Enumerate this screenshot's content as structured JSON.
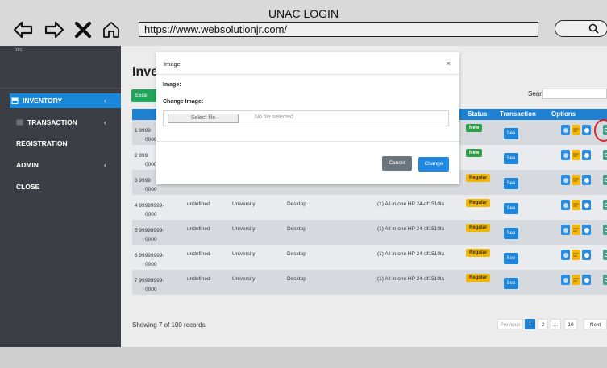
{
  "window": {
    "title": "UNAC LOGIN",
    "url": "https://www.websolutionjr.com/"
  },
  "sidebar": {
    "brand": "otic",
    "items": [
      {
        "label": "INVENTORY",
        "icon": "inventory-icon",
        "has_chevron": true,
        "chevron": "‹",
        "active": true
      },
      {
        "label": "TRANSACTION",
        "icon": "transaction-icon",
        "has_chevron": true,
        "chevron": "‹",
        "active": false
      },
      {
        "label": "REGISTRATION",
        "icon": "",
        "has_chevron": false,
        "chevron": "",
        "active": false
      },
      {
        "label": "ADMIN",
        "icon": "",
        "has_chevron": true,
        "chevron": "‹",
        "active": false
      },
      {
        "label": "CLOSE",
        "icon": "",
        "has_chevron": false,
        "chevron": "",
        "active": false
      }
    ]
  },
  "main": {
    "title": "Inver",
    "excel_label": "Exce",
    "search_label": "Search:",
    "search_value": "",
    "columns": [
      "Co",
      "Status",
      "Transaction",
      "Options"
    ],
    "rows": [
      {
        "id_top": "1  9999",
        "id_bottom": "0000",
        "c2": "",
        "c3": "",
        "c4": "",
        "c5": "",
        "status": "New",
        "status_type": "new",
        "see": "See"
      },
      {
        "id_top": "2  999",
        "id_bottom": "0000",
        "c2": "",
        "c3": "",
        "c4": "",
        "c5": "",
        "status": "New",
        "status_type": "new",
        "see": "See"
      },
      {
        "id_top": "3  9999",
        "id_bottom": "0000",
        "c2": "",
        "c3": "",
        "c4": "",
        "c5": "",
        "status": "Regular",
        "status_type": "regular",
        "see": "See"
      },
      {
        "id_top": "4  99999999-",
        "id_bottom": "0000",
        "c2": "undefined",
        "c3": "University",
        "c4": "Desktop",
        "c5": "(1) All in one HP 24-df1510la",
        "status": "Regular",
        "status_type": "regular",
        "see": "See"
      },
      {
        "id_top": "5  99999999-",
        "id_bottom": "0000",
        "c2": "undefined",
        "c3": "University",
        "c4": "Desktop",
        "c5": "(1) All in one HP 24-df1510la",
        "status": "Regular",
        "status_type": "regular",
        "see": "See"
      },
      {
        "id_top": "6  99999999-",
        "id_bottom": "0000",
        "c2": "undefined",
        "c3": "University",
        "c4": "Desktop",
        "c5": "(1) All in one HP 24-df1510la",
        "status": "Regular",
        "status_type": "regular",
        "see": "See"
      },
      {
        "id_top": "7  99999999-",
        "id_bottom": "0000",
        "c2": "undefined",
        "c3": "University",
        "c4": "Desktop",
        "c5": "(1) All in one HP 24-df1510la",
        "status": "Regular",
        "status_type": "regular",
        "see": "See"
      }
    ],
    "showing": "Showing 7 of 100 records",
    "pagination": {
      "prev": "Previous",
      "p1": "1",
      "p2": "2",
      "dots": "...",
      "p10": "10",
      "next": "Next"
    }
  },
  "modal": {
    "title": "Image",
    "close": "×",
    "image_label": "Image:",
    "change_label": "Change Image:",
    "file_button": "Select file",
    "file_status": "No file selected",
    "cancel": "Cancel",
    "change": "Change"
  },
  "colors": {
    "sidebar_bg": "#3b3e45",
    "accent": "#1f7fd0",
    "new_badge": "#2e9e49",
    "regular_badge": "#f1b708",
    "highlight": "#d9232d"
  }
}
